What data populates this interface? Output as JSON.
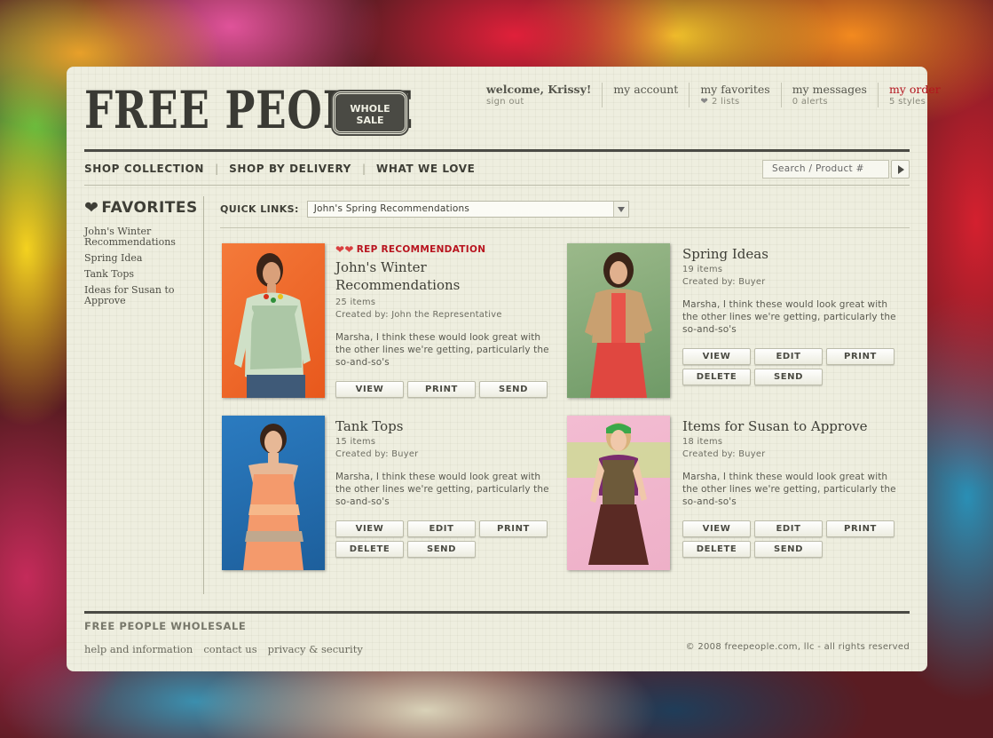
{
  "brand": {
    "logo_text": "FREE PEOPLE",
    "badge_line1": "WHOLE",
    "badge_line2": "SALE"
  },
  "topnav": {
    "welcome": "welcome, Krissy!",
    "sign_out": "sign out",
    "my_account": "my account",
    "my_favorites": "my favorites",
    "favorites_count": "2 lists",
    "my_messages": "my messages",
    "messages_count": "0 alerts",
    "my_order": "my order",
    "order_count": "5 styles"
  },
  "mainnav": {
    "items": [
      "SHOP COLLECTION",
      "SHOP BY DELIVERY",
      "WHAT WE LOVE"
    ],
    "search_placeholder": "Search / Product #"
  },
  "sidebar": {
    "title": "FAVORITES",
    "items": [
      "John's Winter Recommendations",
      "Spring Idea",
      "Tank Tops",
      "Ideas for Susan to Approve"
    ]
  },
  "quick_links": {
    "label": "QUICK LINKS:",
    "selected": "John's Spring Recommendations"
  },
  "cards": [
    {
      "badge": "REP RECOMMENDATION",
      "title": "John's Winter Recommendations",
      "items": "25 items",
      "created": "Created by: John the Representative",
      "desc": "Marsha, I think these would look great with the other lines we're getting, particularly the so-and-so's",
      "buttons": [
        "VIEW",
        "PRINT",
        "SEND"
      ]
    },
    {
      "title": "Spring Ideas",
      "items": "19 items",
      "created": "Created by: Buyer",
      "desc": "Marsha, I think these would look great with the other lines we're getting, particularly the so-and-so's",
      "buttons": [
        "VIEW",
        "EDIT",
        "PRINT",
        "DELETE",
        "SEND"
      ]
    },
    {
      "title": "Tank Tops",
      "items": "15 items",
      "created": "Created by: Buyer",
      "desc": "Marsha, I think these would look great with the other lines we're getting, particularly the so-and-so's",
      "buttons": [
        "VIEW",
        "EDIT",
        "PRINT",
        "DELETE",
        "SEND"
      ]
    },
    {
      "title": "Items for Susan to Approve",
      "items": "18 items",
      "created": "Created by: Buyer",
      "desc": "Marsha, I think these would look great with the other lines we're getting, particularly the so-and-so's",
      "buttons": [
        "VIEW",
        "EDIT",
        "PRINT",
        "DELETE",
        "SEND"
      ]
    }
  ],
  "footer": {
    "title": "FREE PEOPLE WHOLESALE",
    "links": [
      "help and information",
      "contact us",
      "privacy & security"
    ],
    "copyright": "© 2008 freepeople.com, llc - all rights reserved"
  },
  "colors": {
    "panel_bg": "#eeeedf",
    "text_dark": "#3e3e36",
    "accent_red": "#b3141e",
    "rule": "#4a4a44"
  }
}
